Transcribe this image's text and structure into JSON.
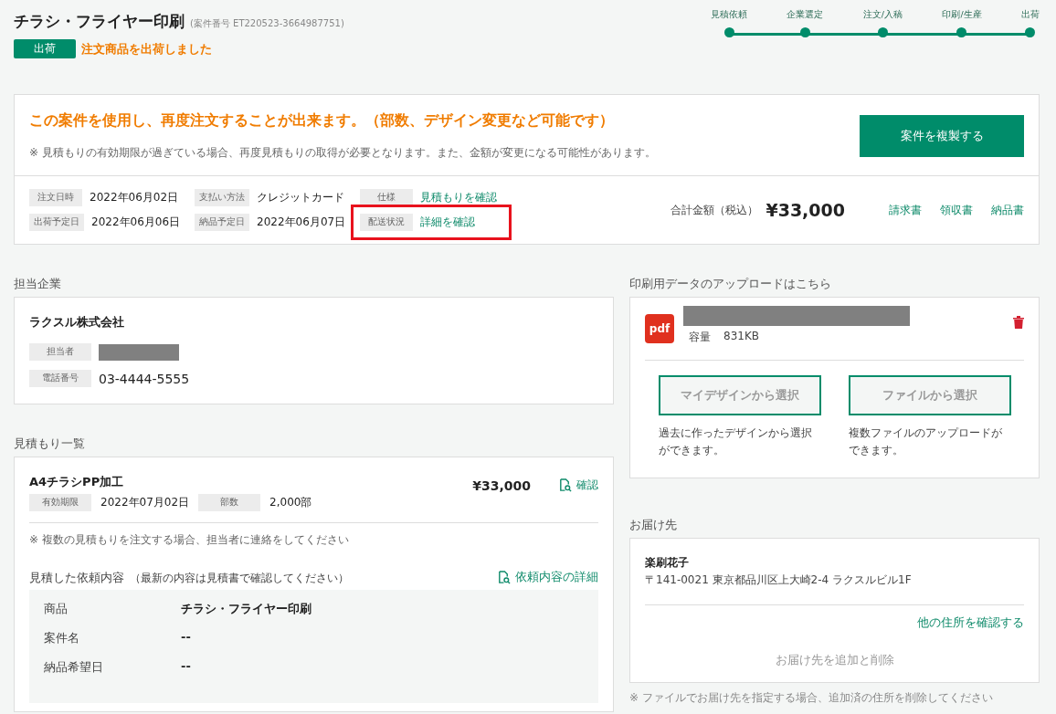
{
  "header": {
    "title": "チラシ・フライヤー印刷",
    "case_number": "(案件番号 ET220523-3664987751)",
    "status_badge": "出荷",
    "status_message": "注文商品を出荷しました"
  },
  "progress": [
    {
      "label": "見積依頼",
      "done": true
    },
    {
      "label": "企業選定",
      "done": true
    },
    {
      "label": "注文/入稿",
      "done": true
    },
    {
      "label": "印刷/生産",
      "done": true
    },
    {
      "label": "出荷",
      "done": true
    }
  ],
  "reorder": {
    "headline": "この案件を使用し、再度注文することが出来ます。（部数、デザイン変更など可能です）",
    "note": "※ 見積もりの有効期限が過ぎている場合、再度見積もりの取得が必要となります。また、金額が変更になる可能性があります。",
    "button": "案件を複製する"
  },
  "order_info": {
    "fields": [
      {
        "label": "注文日時",
        "value": "2022年06月02日",
        "kind": "text",
        "highlighted": false
      },
      {
        "label": "支払い方法",
        "value": "クレジットカード",
        "kind": "text",
        "highlighted": false
      },
      {
        "label": "仕様",
        "value": "見積もりを確認",
        "kind": "link",
        "highlighted": false
      },
      {
        "label": "出荷予定日",
        "value": "2022年06月06日",
        "kind": "text",
        "highlighted": false
      },
      {
        "label": "納品予定日",
        "value": "2022年06月07日",
        "kind": "text",
        "highlighted": false
      },
      {
        "label": "配送状況",
        "value": "詳細を確認",
        "kind": "link",
        "highlighted": true
      }
    ],
    "total_label": "合計金額（税込）",
    "total": "¥33,000",
    "documents": [
      "請求書",
      "領収書",
      "納品書"
    ]
  },
  "company": {
    "heading": "担当企業",
    "name": "ラクスル株式会社",
    "fields": [
      {
        "label": "担当者",
        "kind": "redacted"
      },
      {
        "label": "電話番号",
        "value": "03-4444-5555",
        "kind": "text"
      }
    ]
  },
  "quotes": {
    "heading": "見積もり一覧",
    "items": [
      {
        "name": "A4チラシPP加工",
        "fields": [
          {
            "label": "有効期限",
            "value": "2022年07月02日"
          },
          {
            "label": "部数",
            "value": "2,000部"
          }
        ],
        "price": "¥33,000",
        "action": "確認"
      }
    ],
    "note": "※ 複数の見積もりを注文する場合、担当者に連絡をしてください",
    "request": {
      "title": "見積した依頼内容",
      "subtitle": "（最新の内容は見積書で確認してください）",
      "link": "依頼内容の詳細",
      "rows": [
        {
          "label": "商品",
          "value": "チラシ・フライヤー印刷"
        },
        {
          "label": "案件名",
          "value": "--"
        },
        {
          "label": "納品希望日",
          "value": "--"
        }
      ]
    }
  },
  "upload": {
    "heading": "印刷用データのアップロードはこちら",
    "file": {
      "type_label": "pdf",
      "size_label": "容量",
      "size": "831KB"
    },
    "buttons": [
      {
        "label": "マイデザインから選択",
        "description": "過去に作ったデザインから選択ができます。",
        "disabled": true
      },
      {
        "label": "ファイルから選択",
        "description": "複数ファイルのアップロードができます。",
        "disabled": true
      }
    ]
  },
  "delivery": {
    "heading": "お届け先",
    "name": "楽刷花子",
    "address": "〒141-0021 東京都品川区上大崎2-4 ラクスルビル1F",
    "link": "他の住所を確認する",
    "add_button": {
      "label": "お届け先を追加と削除",
      "disabled": true
    },
    "note": "※ ファイルでお届け先を指定する場合、追加済の住所を削除してください"
  }
}
